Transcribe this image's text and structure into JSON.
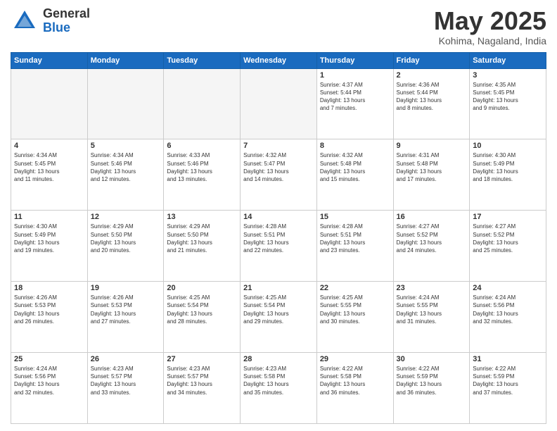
{
  "logo": {
    "general": "General",
    "blue": "Blue"
  },
  "title": "May 2025",
  "location": "Kohima, Nagaland, India",
  "days_of_week": [
    "Sunday",
    "Monday",
    "Tuesday",
    "Wednesday",
    "Thursday",
    "Friday",
    "Saturday"
  ],
  "weeks": [
    [
      {
        "day": "",
        "info": ""
      },
      {
        "day": "",
        "info": ""
      },
      {
        "day": "",
        "info": ""
      },
      {
        "day": "",
        "info": ""
      },
      {
        "day": "1",
        "info": "Sunrise: 4:37 AM\nSunset: 5:44 PM\nDaylight: 13 hours\nand 7 minutes."
      },
      {
        "day": "2",
        "info": "Sunrise: 4:36 AM\nSunset: 5:44 PM\nDaylight: 13 hours\nand 8 minutes."
      },
      {
        "day": "3",
        "info": "Sunrise: 4:35 AM\nSunset: 5:45 PM\nDaylight: 13 hours\nand 9 minutes."
      }
    ],
    [
      {
        "day": "4",
        "info": "Sunrise: 4:34 AM\nSunset: 5:45 PM\nDaylight: 13 hours\nand 11 minutes."
      },
      {
        "day": "5",
        "info": "Sunrise: 4:34 AM\nSunset: 5:46 PM\nDaylight: 13 hours\nand 12 minutes."
      },
      {
        "day": "6",
        "info": "Sunrise: 4:33 AM\nSunset: 5:46 PM\nDaylight: 13 hours\nand 13 minutes."
      },
      {
        "day": "7",
        "info": "Sunrise: 4:32 AM\nSunset: 5:47 PM\nDaylight: 13 hours\nand 14 minutes."
      },
      {
        "day": "8",
        "info": "Sunrise: 4:32 AM\nSunset: 5:48 PM\nDaylight: 13 hours\nand 15 minutes."
      },
      {
        "day": "9",
        "info": "Sunrise: 4:31 AM\nSunset: 5:48 PM\nDaylight: 13 hours\nand 17 minutes."
      },
      {
        "day": "10",
        "info": "Sunrise: 4:30 AM\nSunset: 5:49 PM\nDaylight: 13 hours\nand 18 minutes."
      }
    ],
    [
      {
        "day": "11",
        "info": "Sunrise: 4:30 AM\nSunset: 5:49 PM\nDaylight: 13 hours\nand 19 minutes."
      },
      {
        "day": "12",
        "info": "Sunrise: 4:29 AM\nSunset: 5:50 PM\nDaylight: 13 hours\nand 20 minutes."
      },
      {
        "day": "13",
        "info": "Sunrise: 4:29 AM\nSunset: 5:50 PM\nDaylight: 13 hours\nand 21 minutes."
      },
      {
        "day": "14",
        "info": "Sunrise: 4:28 AM\nSunset: 5:51 PM\nDaylight: 13 hours\nand 22 minutes."
      },
      {
        "day": "15",
        "info": "Sunrise: 4:28 AM\nSunset: 5:51 PM\nDaylight: 13 hours\nand 23 minutes."
      },
      {
        "day": "16",
        "info": "Sunrise: 4:27 AM\nSunset: 5:52 PM\nDaylight: 13 hours\nand 24 minutes."
      },
      {
        "day": "17",
        "info": "Sunrise: 4:27 AM\nSunset: 5:52 PM\nDaylight: 13 hours\nand 25 minutes."
      }
    ],
    [
      {
        "day": "18",
        "info": "Sunrise: 4:26 AM\nSunset: 5:53 PM\nDaylight: 13 hours\nand 26 minutes."
      },
      {
        "day": "19",
        "info": "Sunrise: 4:26 AM\nSunset: 5:53 PM\nDaylight: 13 hours\nand 27 minutes."
      },
      {
        "day": "20",
        "info": "Sunrise: 4:25 AM\nSunset: 5:54 PM\nDaylight: 13 hours\nand 28 minutes."
      },
      {
        "day": "21",
        "info": "Sunrise: 4:25 AM\nSunset: 5:54 PM\nDaylight: 13 hours\nand 29 minutes."
      },
      {
        "day": "22",
        "info": "Sunrise: 4:25 AM\nSunset: 5:55 PM\nDaylight: 13 hours\nand 30 minutes."
      },
      {
        "day": "23",
        "info": "Sunrise: 4:24 AM\nSunset: 5:55 PM\nDaylight: 13 hours\nand 31 minutes."
      },
      {
        "day": "24",
        "info": "Sunrise: 4:24 AM\nSunset: 5:56 PM\nDaylight: 13 hours\nand 32 minutes."
      }
    ],
    [
      {
        "day": "25",
        "info": "Sunrise: 4:24 AM\nSunset: 5:56 PM\nDaylight: 13 hours\nand 32 minutes."
      },
      {
        "day": "26",
        "info": "Sunrise: 4:23 AM\nSunset: 5:57 PM\nDaylight: 13 hours\nand 33 minutes."
      },
      {
        "day": "27",
        "info": "Sunrise: 4:23 AM\nSunset: 5:57 PM\nDaylight: 13 hours\nand 34 minutes."
      },
      {
        "day": "28",
        "info": "Sunrise: 4:23 AM\nSunset: 5:58 PM\nDaylight: 13 hours\nand 35 minutes."
      },
      {
        "day": "29",
        "info": "Sunrise: 4:22 AM\nSunset: 5:58 PM\nDaylight: 13 hours\nand 36 minutes."
      },
      {
        "day": "30",
        "info": "Sunrise: 4:22 AM\nSunset: 5:59 PM\nDaylight: 13 hours\nand 36 minutes."
      },
      {
        "day": "31",
        "info": "Sunrise: 4:22 AM\nSunset: 5:59 PM\nDaylight: 13 hours\nand 37 minutes."
      }
    ]
  ]
}
